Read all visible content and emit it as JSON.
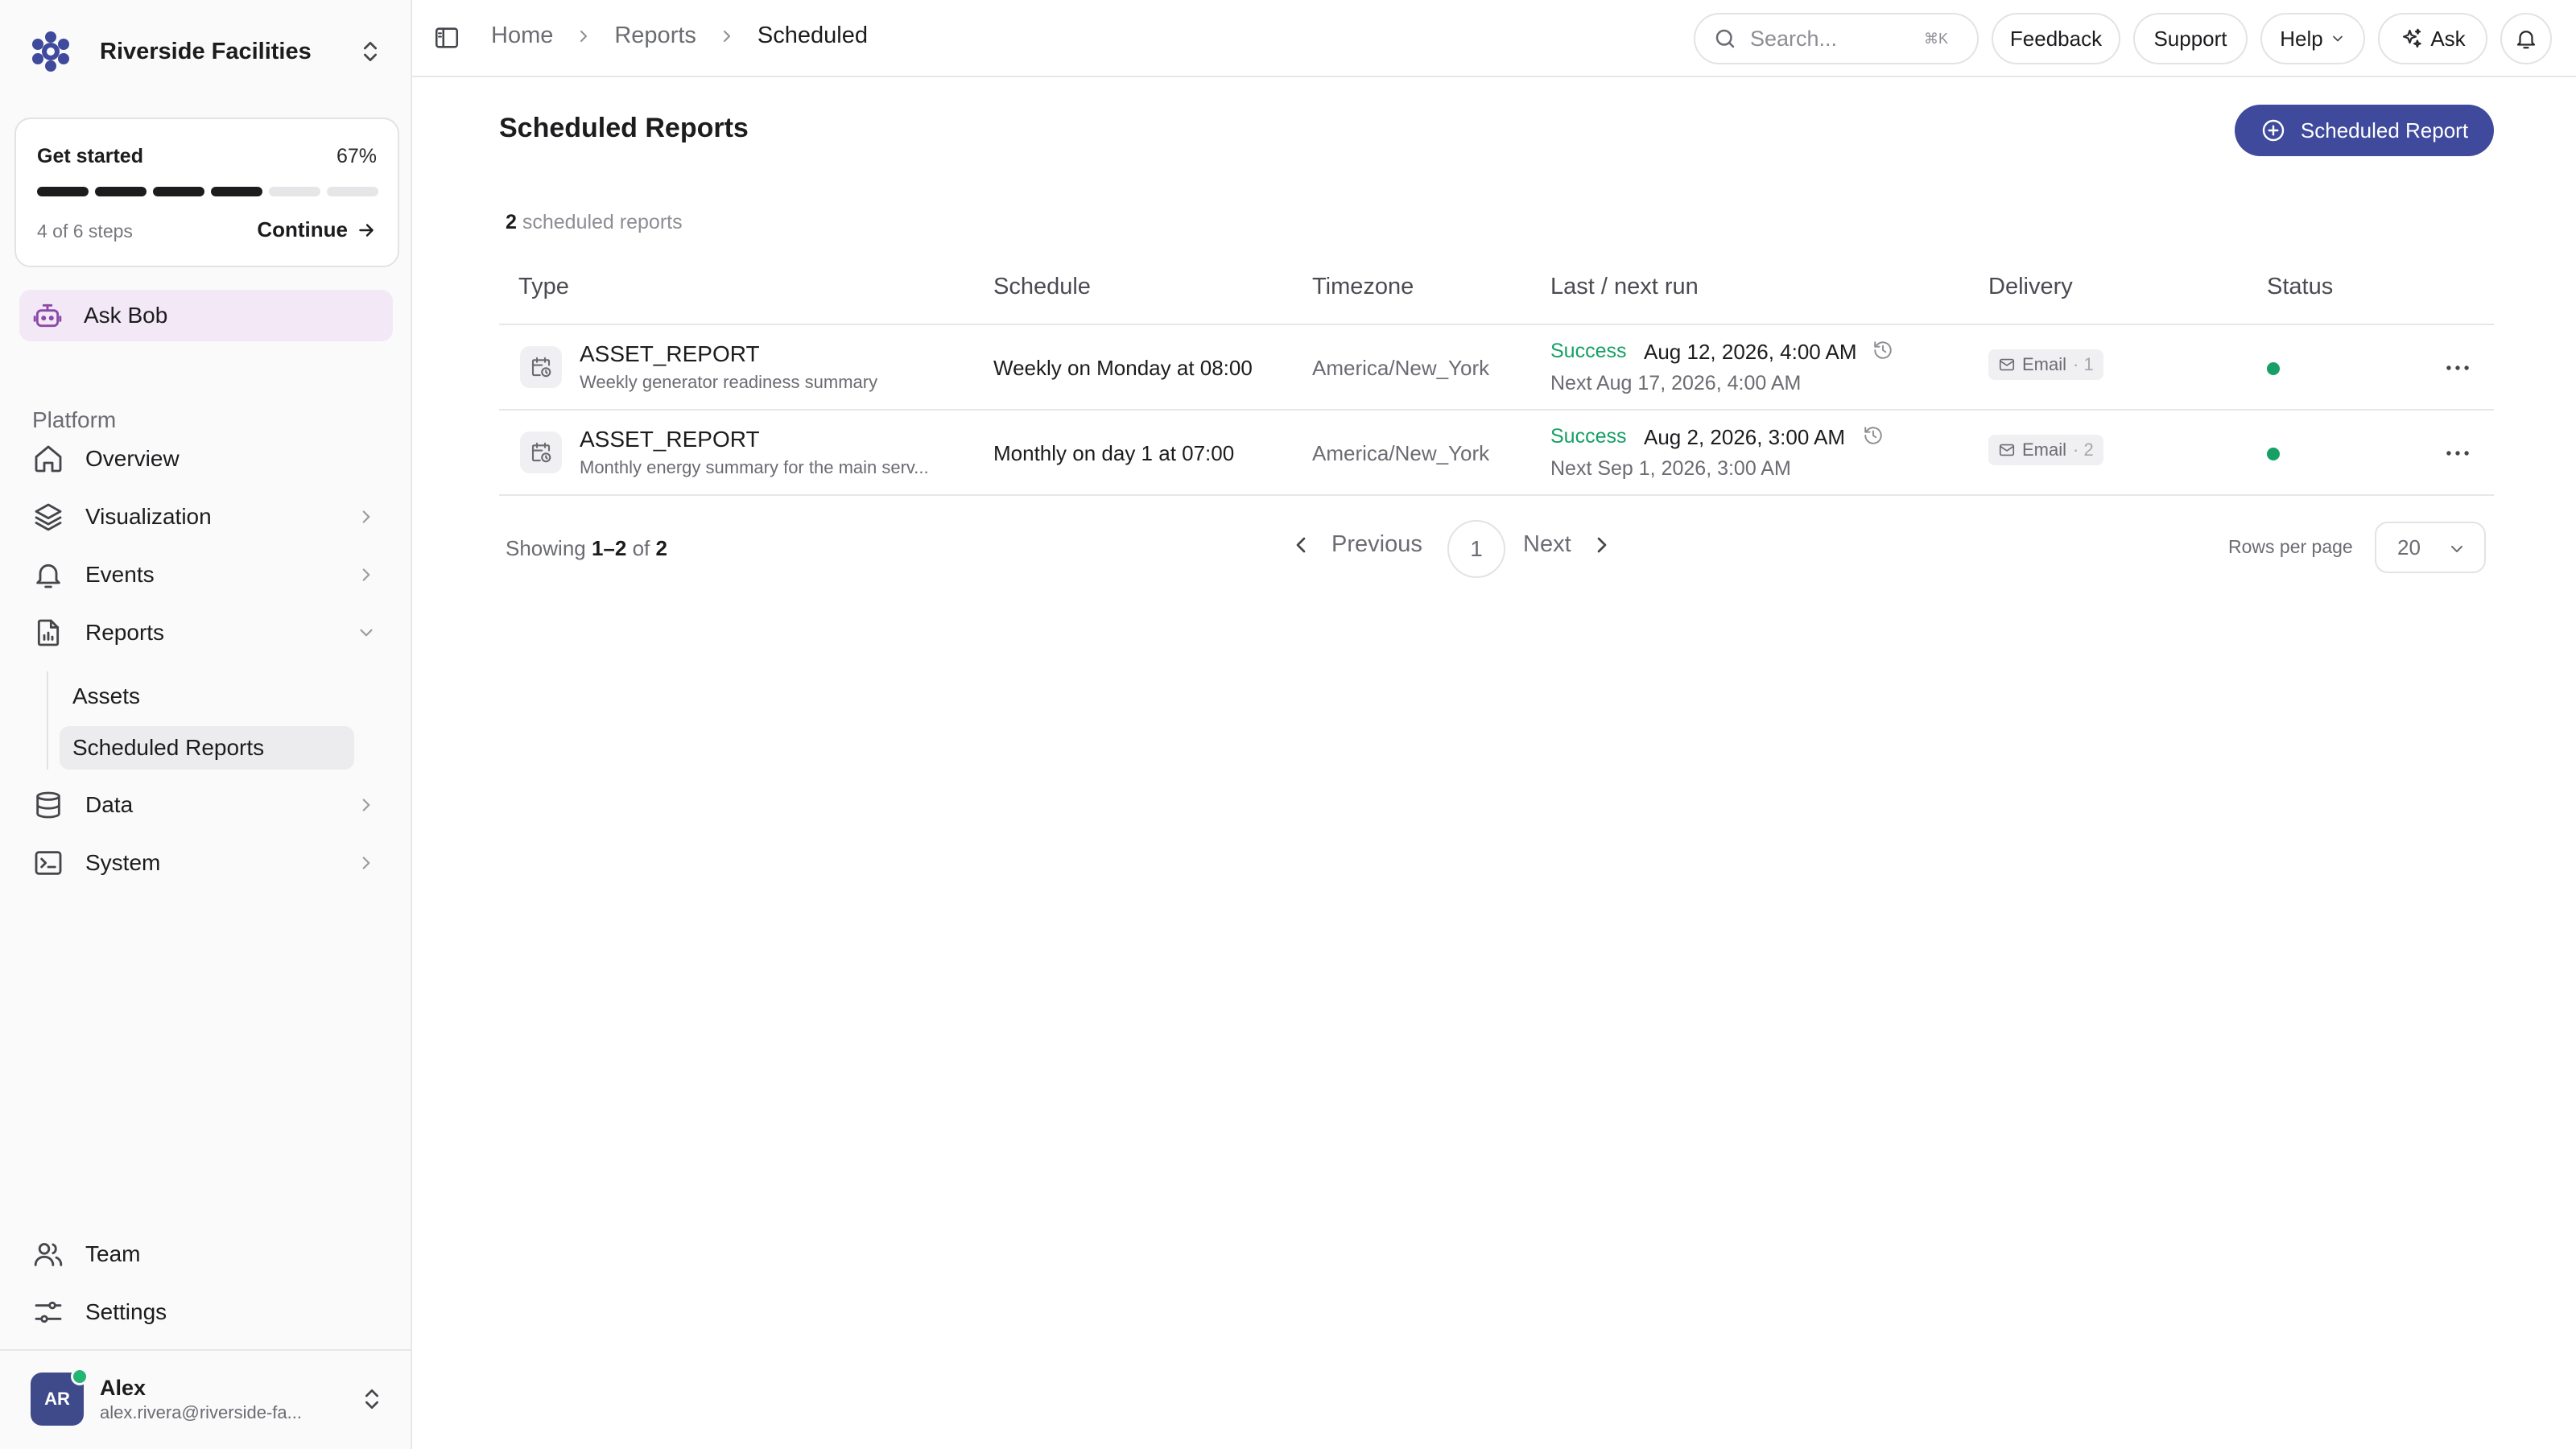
{
  "org": {
    "name": "Riverside Facilities"
  },
  "get_started": {
    "title": "Get started",
    "percent": "67%",
    "steps_text": "4 of 6 steps",
    "completed": 4,
    "total": 6,
    "continue_label": "Continue"
  },
  "ask_bob": {
    "label": "Ask Bob"
  },
  "sidebar": {
    "section": "Platform",
    "items": [
      {
        "label": "Overview",
        "icon": "home-icon"
      },
      {
        "label": "Visualization",
        "icon": "layers-icon"
      },
      {
        "label": "Events",
        "icon": "bell-icon"
      },
      {
        "label": "Reports",
        "icon": "report-icon"
      },
      {
        "label": "Data",
        "icon": "database-icon"
      },
      {
        "label": "System",
        "icon": "terminal-icon"
      }
    ],
    "reports_sub": [
      {
        "label": "Assets"
      },
      {
        "label": "Scheduled Reports"
      }
    ],
    "bottom": [
      {
        "label": "Team",
        "icon": "users-icon"
      },
      {
        "label": "Settings",
        "icon": "sliders-icon"
      }
    ]
  },
  "user": {
    "initials": "AR",
    "name": "Alex",
    "email": "alex.rivera@riverside-fa..."
  },
  "topbar": {
    "breadcrumbs": [
      "Home",
      "Reports",
      "Scheduled"
    ],
    "search_placeholder": "Search...",
    "search_shortcut": "⌘K",
    "feedback": "Feedback",
    "support": "Support",
    "help": "Help",
    "ask": "Ask"
  },
  "page": {
    "title": "Scheduled Reports",
    "new_button": "Scheduled Report",
    "count": "2",
    "count_suffix": "scheduled reports"
  },
  "table": {
    "columns": [
      "Type",
      "Schedule",
      "Timezone",
      "Last / next run",
      "Delivery",
      "Status"
    ],
    "rows": [
      {
        "type": "ASSET_REPORT",
        "description": "Weekly generator readiness summary",
        "schedule": "Weekly on Monday at 08:00",
        "timezone": "America/New_York",
        "last_status": "Success",
        "last_run": "Aug 12, 2026, 4:00 AM",
        "next_run": "Next Aug 17, 2026, 4:00 AM",
        "delivery": "Email",
        "delivery_count": "· 1"
      },
      {
        "type": "ASSET_REPORT",
        "description": "Monthly energy summary for the main serv...",
        "schedule": "Monthly on day 1 at 07:00",
        "timezone": "America/New_York",
        "last_status": "Success",
        "last_run": "Aug 2, 2026, 3:00 AM",
        "next_run": "Next Sep 1, 2026, 3:00 AM",
        "delivery": "Email",
        "delivery_count": "· 2"
      }
    ]
  },
  "pagination": {
    "showing_prefix": "Showing",
    "range": "1–2",
    "of": "of",
    "total": "2",
    "previous": "Previous",
    "page": "1",
    "next": "Next",
    "rows_per_page_label": "Rows per page",
    "rows_per_page": "20"
  },
  "colors": {
    "primary": "#3f4a9c",
    "success": "#16a066",
    "ask_bob_bg": "#f3e8f6",
    "avatar": "#3f4a8a"
  }
}
